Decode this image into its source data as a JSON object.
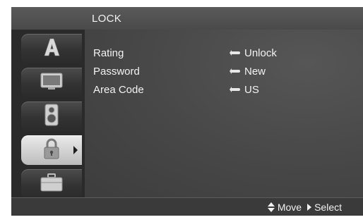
{
  "header": {
    "title": "LOCK"
  },
  "sidebar": {
    "tabs": [
      {
        "icon": "language-a-icon",
        "active": false
      },
      {
        "icon": "display-tv-icon",
        "active": false
      },
      {
        "icon": "audio-speaker-icon",
        "active": false
      },
      {
        "icon": "padlock-icon",
        "active": true
      },
      {
        "icon": "briefcase-others-icon",
        "active": false
      }
    ]
  },
  "menu": {
    "items": [
      {
        "label": "Rating",
        "value": "Unlock"
      },
      {
        "label": "Password",
        "value": "New"
      },
      {
        "label": "Area Code",
        "value": "US"
      }
    ]
  },
  "footer": {
    "move_label": "Move",
    "select_label": "Select"
  },
  "colors": {
    "background": "#3e3e3e",
    "sidebar": "#2a2a2a",
    "active_tab": "#d8d8d8",
    "text": "#f2f2f2"
  }
}
